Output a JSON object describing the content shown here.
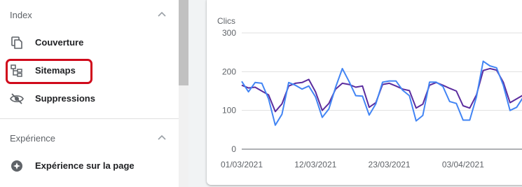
{
  "sidebar": {
    "index_section": {
      "title": "Index"
    },
    "items": [
      {
        "label": "Couverture",
        "icon": "file-copy-icon"
      },
      {
        "label": "Sitemaps",
        "icon": "sitemap-icon",
        "highlighted": true
      },
      {
        "label": "Suppressions",
        "icon": "eye-off-icon"
      }
    ],
    "experience_section": {
      "title": "Expérience"
    },
    "experience_items": [
      {
        "label": "Expérience sur la page",
        "icon": "plus-circle-icon"
      }
    ]
  },
  "colors": {
    "clicks_series": "#5b2c9e",
    "impressions_series": "#4285f4",
    "highlight_border": "#d00a1b"
  },
  "chart_data": {
    "type": "line",
    "ylabel": "Clics",
    "ylim": [
      0,
      300
    ],
    "yticks": [
      0,
      100,
      200,
      300
    ],
    "xtick_labels": [
      "01/03/2021",
      "12/03/2021",
      "23/03/2021",
      "03/04/2021"
    ],
    "grid": true,
    "x": [
      "2021-03-01",
      "2021-03-02",
      "2021-03-03",
      "2021-03-04",
      "2021-03-05",
      "2021-03-06",
      "2021-03-07",
      "2021-03-08",
      "2021-03-09",
      "2021-03-10",
      "2021-03-11",
      "2021-03-12",
      "2021-03-13",
      "2021-03-14",
      "2021-03-15",
      "2021-03-16",
      "2021-03-17",
      "2021-03-18",
      "2021-03-19",
      "2021-03-20",
      "2021-03-21",
      "2021-03-22",
      "2021-03-23",
      "2021-03-24",
      "2021-03-25",
      "2021-03-26",
      "2021-03-27",
      "2021-03-28",
      "2021-03-29",
      "2021-03-30",
      "2021-03-31",
      "2021-04-01",
      "2021-04-02",
      "2021-04-03",
      "2021-04-04",
      "2021-04-05",
      "2021-04-06",
      "2021-04-07",
      "2021-04-08",
      "2021-04-09",
      "2021-04-10",
      "2021-04-11",
      "2021-04-12"
    ],
    "series": [
      {
        "values": [
          165,
          158,
          160,
          150,
          140,
          97,
          117,
          163,
          170,
          172,
          180,
          148,
          100,
          118,
          155,
          170,
          167,
          160,
          163,
          108,
          120,
          167,
          170,
          163,
          155,
          151,
          106,
          116,
          165,
          172,
          165,
          157,
          150,
          112,
          106,
          140,
          203,
          208,
          204,
          173,
          120,
          130,
          140
        ]
      },
      {
        "values": [
          175,
          148,
          172,
          170,
          130,
          62,
          90,
          172,
          165,
          155,
          163,
          135,
          82,
          104,
          160,
          208,
          175,
          138,
          137,
          88,
          117,
          173,
          176,
          176,
          152,
          138,
          73,
          87,
          173,
          173,
          162,
          123,
          118,
          75,
          75,
          135,
          227,
          215,
          210,
          165,
          100,
          108,
          135
        ]
      }
    ]
  }
}
